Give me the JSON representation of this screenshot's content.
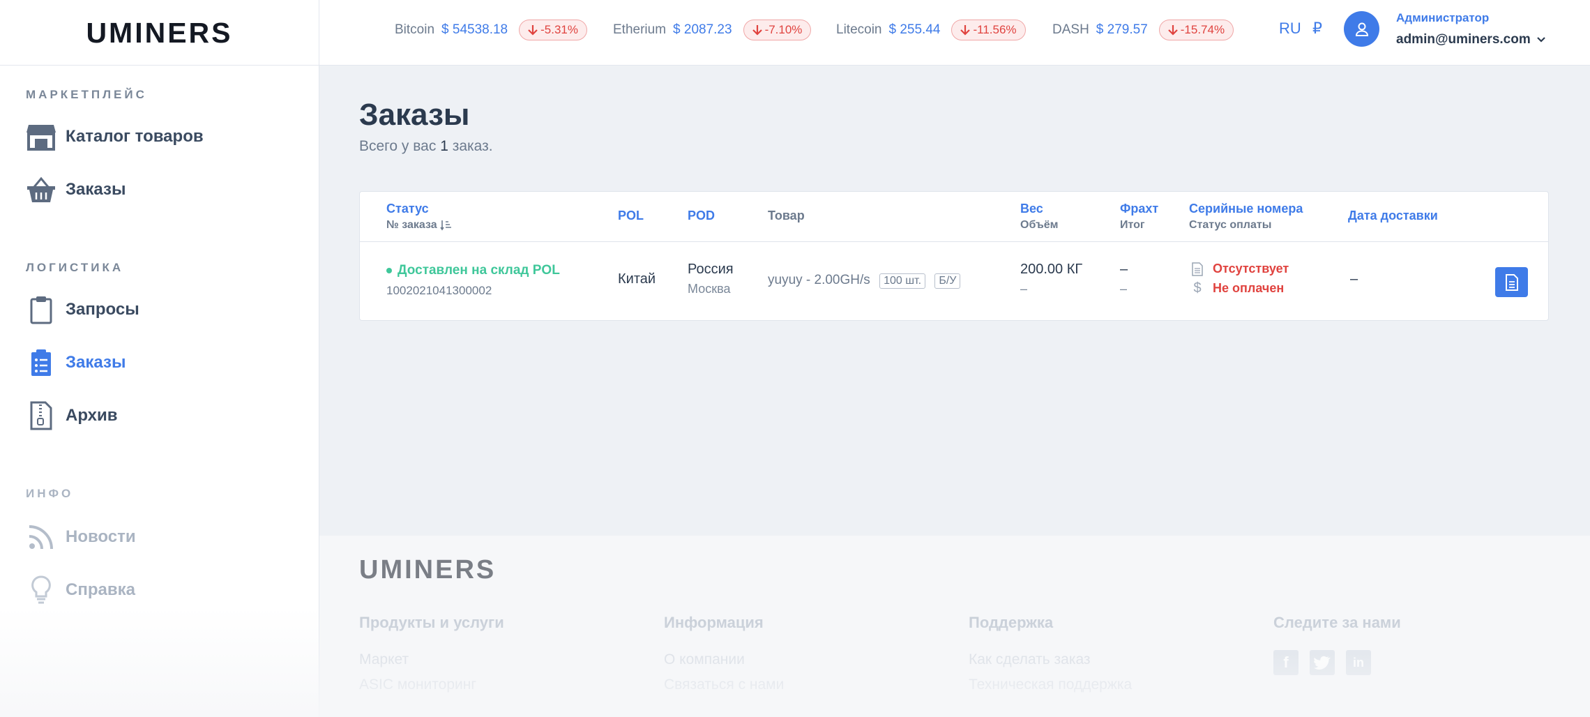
{
  "header": {
    "logo": "UMINERS",
    "tickers": [
      {
        "name": "Bitcoin",
        "price": "$ 54538.18",
        "change": "-5.31%"
      },
      {
        "name": "Etherium",
        "price": "$ 2087.23",
        "change": "-7.10%"
      },
      {
        "name": "Litecoin",
        "price": "$ 255.44",
        "change": "-11.56%"
      },
      {
        "name": "DASH",
        "price": "$ 279.57",
        "change": "-15.74%"
      }
    ],
    "language": "RU",
    "currency": "₽",
    "user_role": "Администратор",
    "user_email": "admin@uminers.com"
  },
  "sidebar": {
    "sections": [
      {
        "title": "МАРКЕТПЛЕЙС",
        "items": [
          {
            "label": "Каталог товаров",
            "icon": "store-icon"
          },
          {
            "label": "Заказы",
            "icon": "basket-icon"
          }
        ]
      },
      {
        "title": "ЛОГИСТИКА",
        "items": [
          {
            "label": "Запросы",
            "icon": "clipboard-icon"
          },
          {
            "label": "Заказы",
            "icon": "clipboard-list-icon",
            "active": true
          },
          {
            "label": "Архив",
            "icon": "archive-file-icon"
          }
        ]
      },
      {
        "title": "ИНФО",
        "items": [
          {
            "label": "Новости",
            "icon": "rss-icon"
          },
          {
            "label": "Справка",
            "icon": "lightbulb-icon"
          }
        ]
      }
    ]
  },
  "main": {
    "title": "Заказы",
    "subtitle_prefix": "Всего у вас",
    "subtitle_count": "1",
    "subtitle_suffix": "заказ.",
    "table": {
      "headers": {
        "status": "Статус",
        "order_no": "№ заказа",
        "pol": "POL",
        "pod": "POD",
        "product": "Товар",
        "weight": "Вес",
        "volume": "Объём",
        "freight": "Фрахт",
        "total": "Итог",
        "serials": "Серийные номера",
        "payment_status": "Статус оплаты",
        "delivery_date": "Дата доставки"
      },
      "rows": [
        {
          "status": "Доставлен на склад POL",
          "order_no": "1002021041300002",
          "pol": "Китай",
          "pod_country": "Россия",
          "pod_city": "Москва",
          "product": "yuyuy - 2.00GH/s",
          "qty_tag": "100 шт.",
          "condition_tag": "Б/У",
          "weight": "200.00 КГ",
          "volume": "–",
          "freight": "–",
          "total": "–",
          "serials": "Отсутствует",
          "payment": "Не оплачен",
          "delivery_date": "–"
        }
      ]
    }
  },
  "footer": {
    "logo": "UMINERS",
    "columns": [
      {
        "title": "Продукты и услуги",
        "links": [
          "Маркет",
          "ASIC мониторинг"
        ]
      },
      {
        "title": "Информация",
        "links": [
          "О компании",
          "Связаться с нами"
        ]
      },
      {
        "title": "Поддержка",
        "links": [
          "Как сделать заказ",
          "Техническая поддержка"
        ]
      },
      {
        "title": "Следите за нами",
        "links": []
      }
    ]
  },
  "colors": {
    "accent": "#3f7be8",
    "success": "#3fc79a",
    "danger": "#e0433f"
  }
}
